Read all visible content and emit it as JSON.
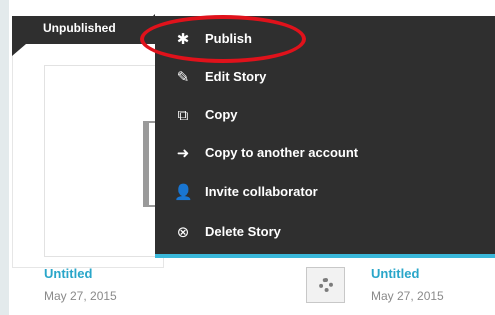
{
  "story_cards": [
    {
      "status": "Unpublished",
      "title": "Untitled",
      "date": "May 27, 2015"
    },
    {
      "title": "Untitled",
      "date": "May 27, 2015"
    }
  ],
  "context_menu": {
    "items": [
      {
        "label": "Publish",
        "icon": "gear-icon"
      },
      {
        "label": "Edit Story",
        "icon": "pencil-icon"
      },
      {
        "label": "Copy",
        "icon": "copy-icon"
      },
      {
        "label": "Copy to another account",
        "icon": "arrow-right-icon"
      },
      {
        "label": "Invite collaborator",
        "icon": "user-icon"
      },
      {
        "label": "Delete Story",
        "icon": "close-circle-icon"
      }
    ],
    "accent_color": "#3ab8da",
    "highlight_color": "#e0121b"
  }
}
